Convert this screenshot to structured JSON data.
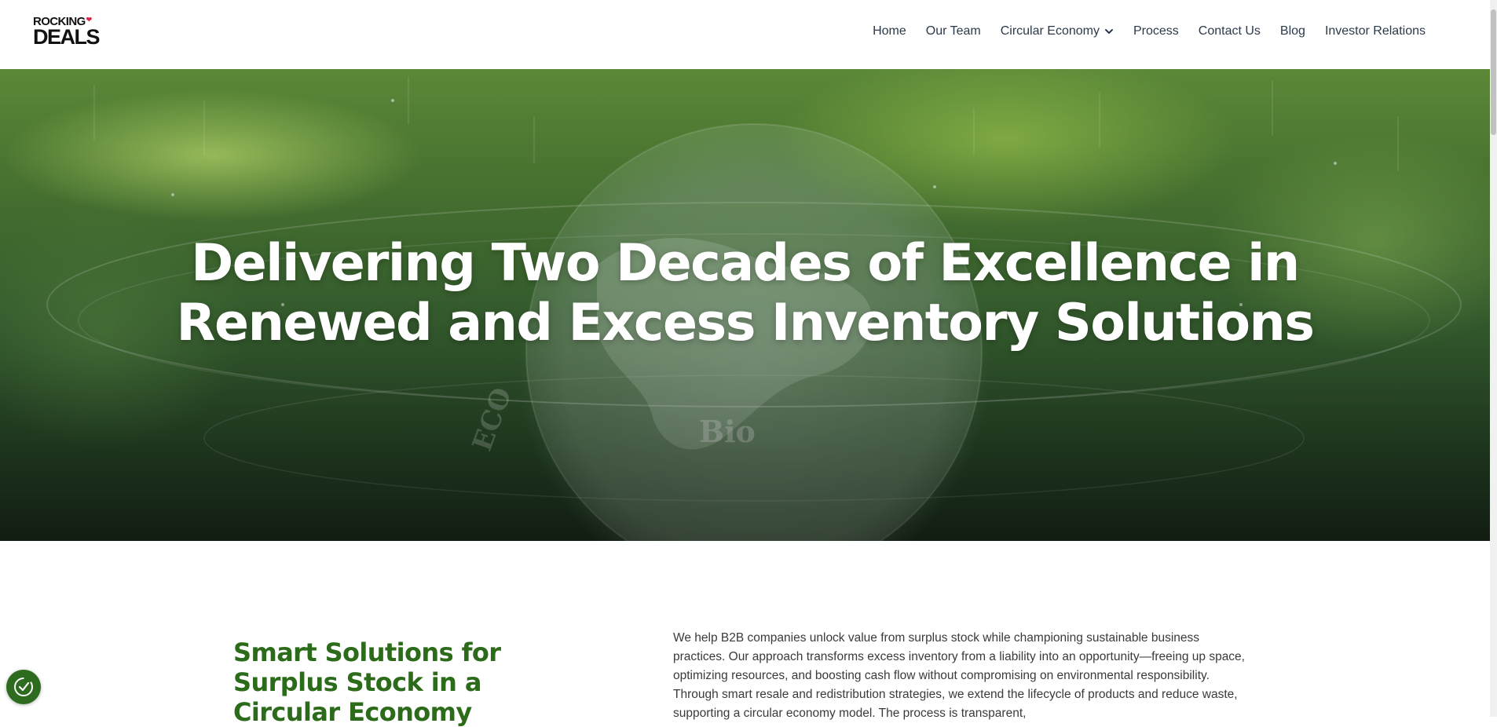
{
  "brand": {
    "logo_top": "ROCKING",
    "logo_bottom": "DEALS",
    "logo_accent_color": "#d6244b"
  },
  "nav": {
    "items": [
      {
        "label": "Home"
      },
      {
        "label": "Our Team"
      },
      {
        "label": "Circular Economy",
        "has_dropdown": true
      },
      {
        "label": "Process"
      },
      {
        "label": "Contact Us"
      },
      {
        "label": "Blog"
      },
      {
        "label": "Investor Relations"
      }
    ],
    "dropdown_icon": "chevron-down-icon"
  },
  "hero": {
    "title_line1": "Delivering Two Decades of Excellence in",
    "title_line2": "Renewed and Excess Inventory Solutions",
    "background": "green blurred globe / eco icons"
  },
  "section": {
    "title": "Smart Solutions for Surplus Stock in a Circular Economy",
    "body": "We help B2B companies unlock value from surplus stock while championing sustainable business practices. Our approach transforms excess inventory from a liability into an opportunity—freeing up space, optimizing resources, and boosting cash flow without compromising on environmental responsibility. Through smart resale and redistribution strategies, we extend the lifecycle of products and reduce waste, supporting a circular economy model. The process is transparent,"
  },
  "colors": {
    "heading_green": "#2b6b1a",
    "nav_text": "#2b3a4a",
    "consent_button": "#2d6b1f"
  },
  "widgets": {
    "consent_icon": "cookie-consent-icon"
  }
}
